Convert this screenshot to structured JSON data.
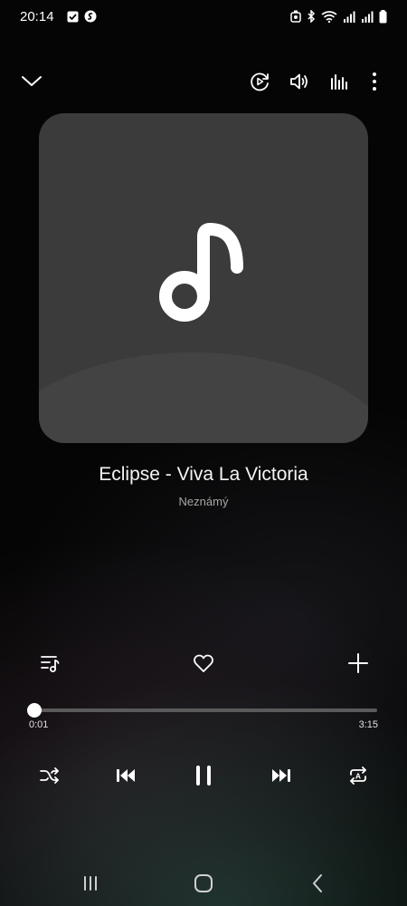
{
  "status_bar": {
    "time": "20:14",
    "icons": [
      "checkbox-notification-icon",
      "shazam-icon",
      "alarm-icon",
      "bluetooth-icon",
      "wifi-icon",
      "signal-icon",
      "signal-icon",
      "battery-icon"
    ]
  },
  "toolbar": {
    "icons": [
      "chevron-down-icon",
      "smart-view-icon",
      "volume-icon",
      "equalizer-icon",
      "more-vert-icon"
    ]
  },
  "album_art": {
    "icon": "music-note-icon"
  },
  "track": {
    "title": "Eclipse - Viva La Victoria",
    "artist": "Neznámý"
  },
  "actions": {
    "icons": [
      "queue-icon",
      "heart-icon",
      "add-icon"
    ]
  },
  "playback": {
    "elapsed": "0:01",
    "total": "3:15",
    "progress_fraction": 0.005
  },
  "controls": {
    "icons": [
      "shuffle-icon",
      "previous-icon",
      "pause-icon",
      "next-icon",
      "repeat-a-icon"
    ]
  },
  "nav_bar": {
    "icons": [
      "recents-icon",
      "home-icon",
      "back-icon"
    ]
  }
}
